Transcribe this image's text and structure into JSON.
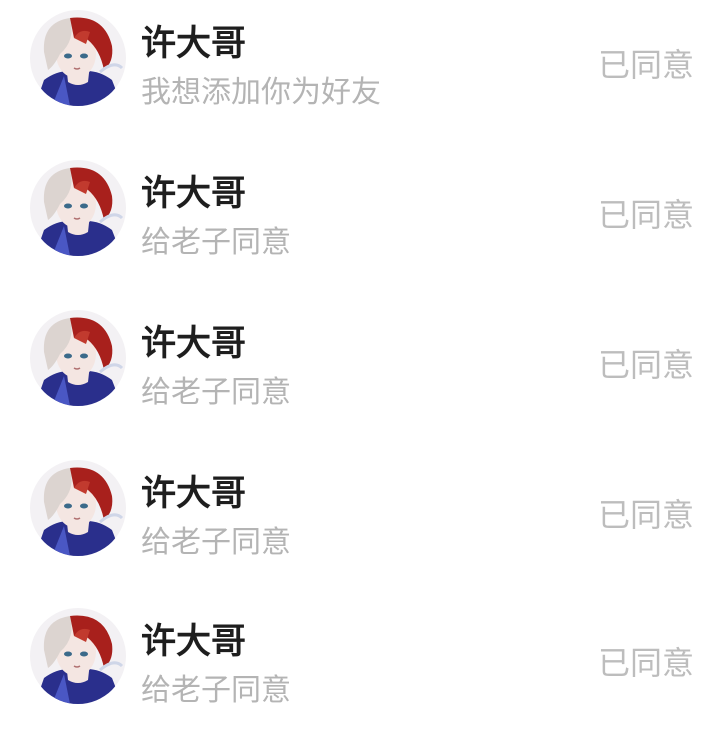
{
  "requests": [
    {
      "name": "许大哥",
      "message": "我想添加你为好友",
      "status": "已同意",
      "avatar_icon": "user-avatar-icon"
    },
    {
      "name": "许大哥",
      "message": "给老子同意",
      "status": "已同意",
      "avatar_icon": "user-avatar-icon"
    },
    {
      "name": "许大哥",
      "message": "给老子同意",
      "status": "已同意",
      "avatar_icon": "user-avatar-icon"
    },
    {
      "name": "许大哥",
      "message": "给老子同意",
      "status": "已同意",
      "avatar_icon": "user-avatar-icon"
    },
    {
      "name": "许大哥",
      "message": "给老子同意",
      "status": "已同意",
      "avatar_icon": "user-avatar-icon"
    }
  ],
  "colors": {
    "name": "#1e1e1e",
    "message": "#b4b4b4",
    "status": "#bdbdbd",
    "hair_white": "#dcd4d0",
    "hair_red": "#a8201c",
    "collar": "#2a2f8c",
    "skin": "#f4e6e2"
  }
}
